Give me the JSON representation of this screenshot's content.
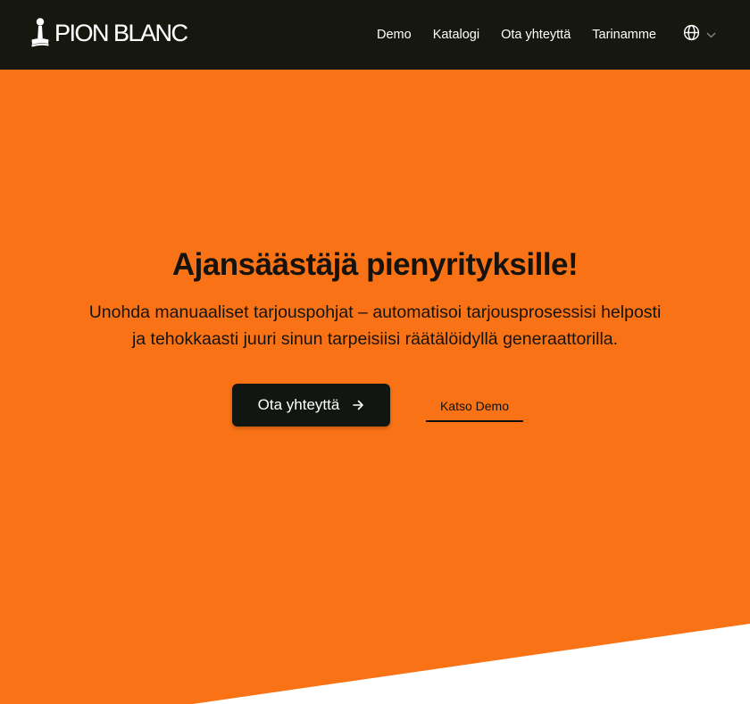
{
  "header": {
    "logo_text": "PION BLANC",
    "logo_icon": "stamp-icon",
    "nav": [
      {
        "label": "Demo"
      },
      {
        "label": "Katalogi"
      },
      {
        "label": "Ota yhteyttä"
      },
      {
        "label": "Tarinamme"
      }
    ],
    "language_icon": "globe-icon",
    "language_chevron": "chevron-down-icon"
  },
  "hero": {
    "title": "Ajansäästäjä pienyrityksille!",
    "subtitle": "Unohda manuaaliset tarjouspohjat – automatisoi tarjousprosessisi helposti ja tehokkaasti juuri sinun tarpeisiisi räätälöidyllä generaattorilla.",
    "primary_cta": "Ota yhteyttä",
    "primary_cta_icon": "arrow-right-icon",
    "secondary_cta": "Katso Demo"
  },
  "colors": {
    "header_bg": "#16170f",
    "hero_bg": "#f97316",
    "button_bg": "#111611",
    "text_dark": "#16130f",
    "white": "#ffffff"
  }
}
